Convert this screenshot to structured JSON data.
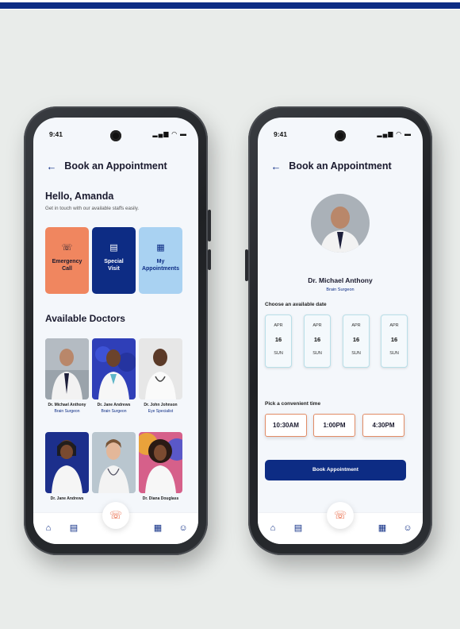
{
  "left_phone": {
    "status_time": "9:41",
    "status_icons": "▂▄▆ ◠ ▬",
    "header_title": "Book an Appointment",
    "greeting": "Hello, Amanda",
    "greeting_sub": "Get in touch with our available staffs easily.",
    "quick_actions": [
      {
        "label_1": "Emergency",
        "label_2": "Call",
        "icon": "phone-icon"
      },
      {
        "label_1": "Special",
        "label_2": "Visit",
        "icon": "clipboard-icon"
      },
      {
        "label_1": "My",
        "label_2": "Appointments",
        "icon": "calendar-icon"
      }
    ],
    "section_title": "Available Doctors",
    "doctors": [
      {
        "name": "Dr. Michael Anthony",
        "specialty": "Brain Surgeon"
      },
      {
        "name": "Dr. Jane Andrews",
        "specialty": "Brain Surgeon"
      },
      {
        "name": "Dr. John Johnson",
        "specialty": "Eye Specialist"
      },
      {
        "name": "Dr. Jane Andrews",
        "specialty": ""
      },
      {
        "name": "",
        "specialty": ""
      },
      {
        "name": "Dr. Diana Douglass",
        "specialty": ""
      }
    ]
  },
  "right_phone": {
    "status_time": "9:41",
    "status_icons": "▂▄▆ ◠ ▬",
    "header_title": "Book an Appointment",
    "doctor_name": "Dr. Michael Anthony",
    "doctor_specialty": "Brain Surgeon",
    "date_label": "Choose an available date",
    "dates": [
      {
        "month": "APR",
        "day": "16",
        "weekday": "SUN"
      },
      {
        "month": "APR",
        "day": "16",
        "weekday": "SUN"
      },
      {
        "month": "APR",
        "day": "16",
        "weekday": "SUN"
      },
      {
        "month": "APR",
        "day": "16",
        "weekday": "SUN"
      }
    ],
    "time_label": "Pick a convenient time",
    "times": [
      "10:30AM",
      "1:00PM",
      "4:30PM"
    ],
    "book_button": "Book Appointment"
  },
  "colors": {
    "brand": "#0d2c84",
    "accent": "#f0865f",
    "light_blue": "#a9d2f2",
    "background": "#e9ecea"
  }
}
